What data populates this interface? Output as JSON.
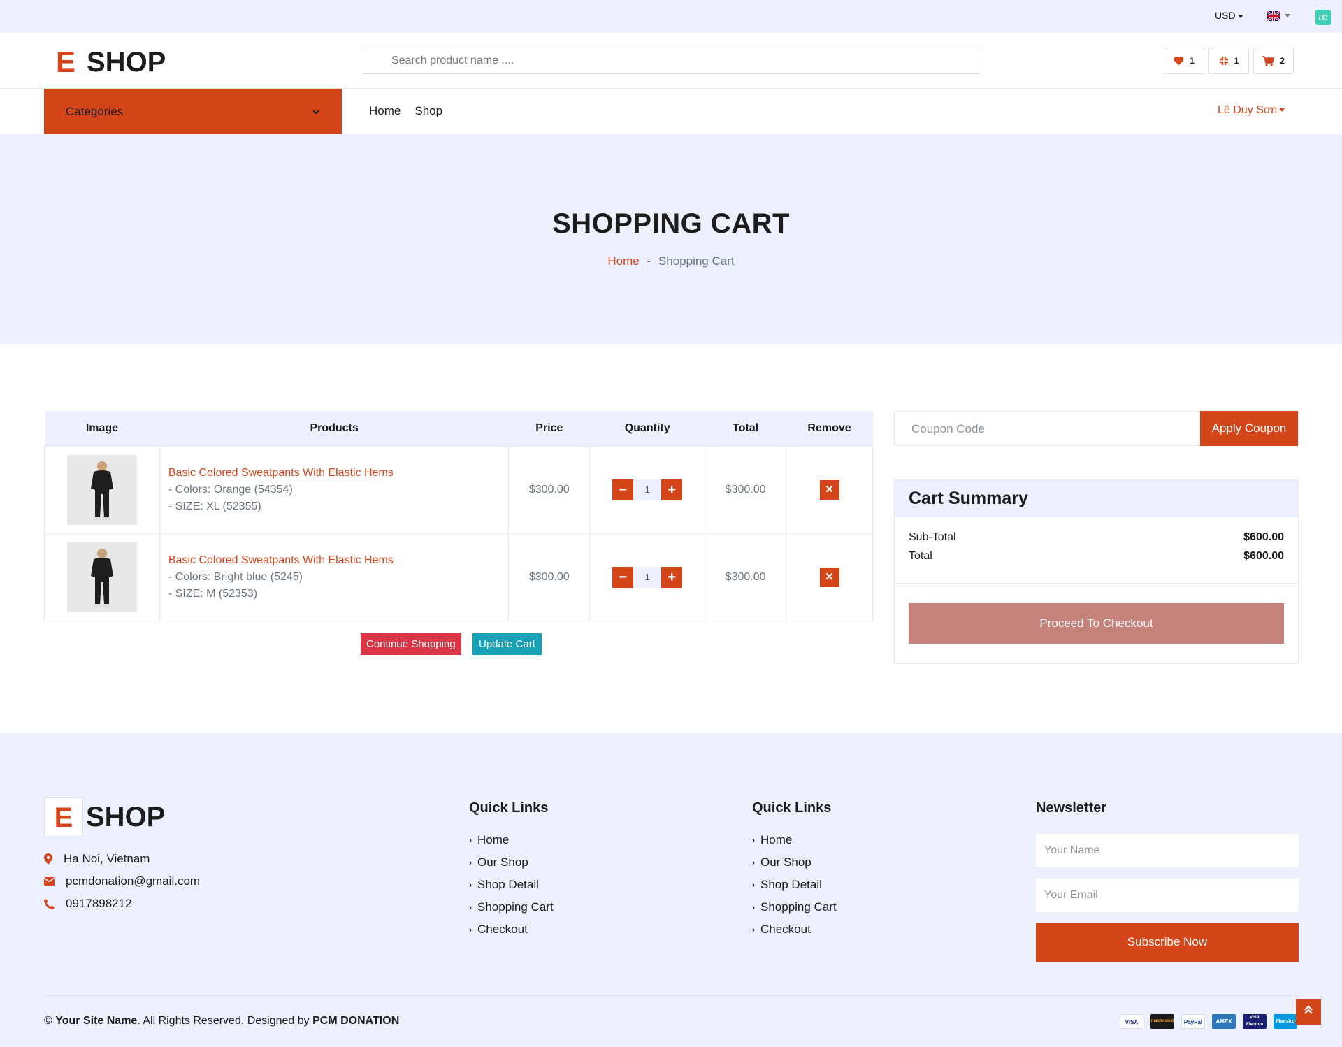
{
  "topbar": {
    "currency": "USD",
    "language_flag": "uk-flag-icon",
    "extension_icon": "æ"
  },
  "header": {
    "logo_letter": "E",
    "logo_word": "SHOP",
    "search_placeholder": "Search product name ....",
    "wishlist_count": "1",
    "compare_count": "1",
    "cart_count": "2"
  },
  "nav": {
    "categories_label": "Categories",
    "links": [
      "Home",
      "Shop"
    ],
    "user_name": "Lê Duy Sơn"
  },
  "page_header": {
    "title": "SHOPPING CART",
    "breadcrumb_home": "Home",
    "breadcrumb_sep": "-",
    "breadcrumb_current": "Shopping Cart"
  },
  "cart": {
    "columns": [
      "Image",
      "Products",
      "Price",
      "Quantity",
      "Total",
      "Remove"
    ],
    "rows": [
      {
        "name": "Basic Colored Sweatpants With Elastic Hems",
        "color": "- Colors: Orange (54354)",
        "size": "- SIZE: XL (52355)",
        "price": "$300.00",
        "qty": "1",
        "total": "$300.00"
      },
      {
        "name": "Basic Colored Sweatpants With Elastic Hems",
        "color": "- Colors: Bright blue (5245)",
        "size": "- SIZE: M (52353)",
        "price": "$300.00",
        "qty": "1",
        "total": "$300.00"
      }
    ],
    "continue_label": "Continue Shopping",
    "update_label": "Update Cart"
  },
  "coupon": {
    "placeholder": "Coupon Code",
    "apply_label": "Apply Coupon"
  },
  "summary": {
    "title": "Cart Summary",
    "subtotal_label": "Sub-Total",
    "subtotal_value": "$600.00",
    "total_label": "Total",
    "total_value": "$600.00",
    "checkout_label": "Proceed To Checkout"
  },
  "footer": {
    "logo_letter": "E",
    "logo_word": "SHOP",
    "address": "Ha Noi, Vietnam",
    "email": "pcmdonation@gmail.com",
    "phone": "0917898212",
    "quick_links_1": {
      "title": "Quick Links",
      "items": [
        "Home",
        "Our Shop",
        "Shop Detail",
        "Shopping Cart",
        "Checkout"
      ]
    },
    "quick_links_2": {
      "title": "Quick Links",
      "items": [
        "Home",
        "Our Shop",
        "Shop Detail",
        "Shopping Cart",
        "Checkout"
      ]
    },
    "newsletter": {
      "title": "Newsletter",
      "name_placeholder": "Your Name",
      "email_placeholder": "Your Email",
      "subscribe_label": "Subscribe Now"
    },
    "copyright_prefix": "©",
    "copyright_site": "Your Site Name",
    "copyright_mid": ". All Rights Reserved. Designed by",
    "copyright_designer": "PCM DONATION",
    "payments": [
      "VISA",
      "mastercard",
      "PayPal",
      "AMEX",
      "VISA Electron",
      "Maestro"
    ]
  },
  "colors": {
    "accent": "#d4451a",
    "light_bg": "#edf1ff",
    "checkout_disabled": "#c5827b",
    "continue_btn": "#dc3545",
    "update_btn": "#17a2b8"
  }
}
